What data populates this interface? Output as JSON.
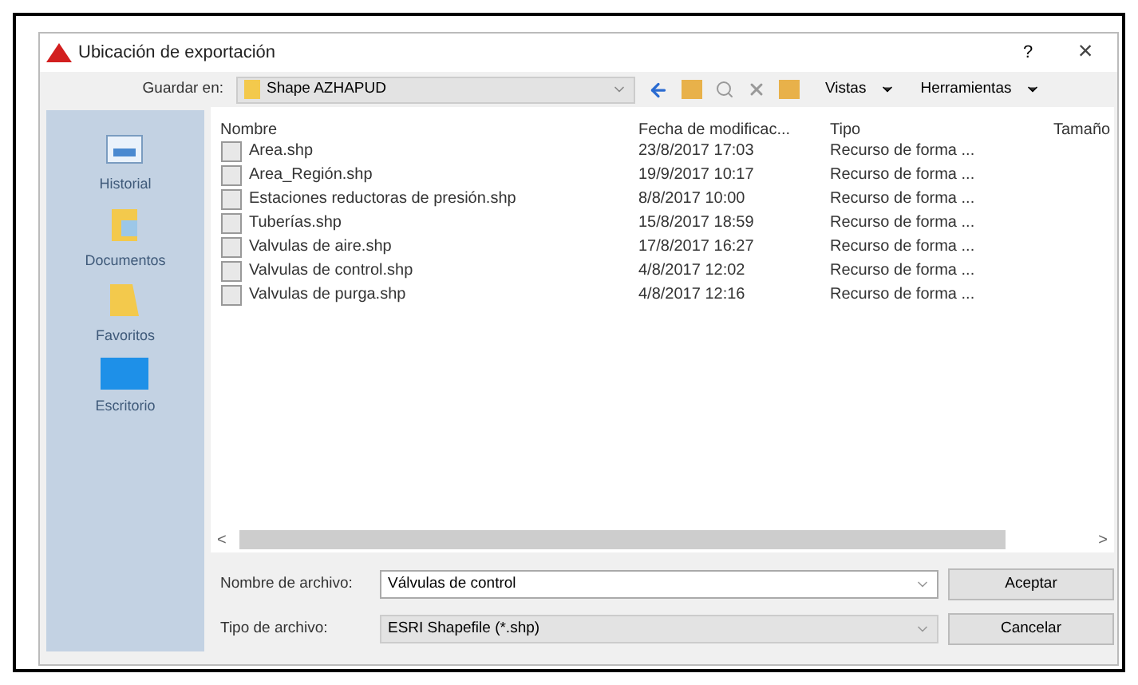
{
  "window": {
    "title": "Ubicación de exportación",
    "help": "?",
    "close": "×"
  },
  "toolbar": {
    "label": "Guardar en:",
    "location": "Shape AZHAPUD",
    "menus": [
      {
        "label": "Vistas"
      },
      {
        "label": "Herramientas"
      }
    ]
  },
  "sidebar": {
    "items": [
      {
        "label": "Historial",
        "kind": "history"
      },
      {
        "label": "Documentos",
        "kind": "documents"
      },
      {
        "label": "Favoritos",
        "kind": "favorites"
      },
      {
        "label": "Escritorio",
        "kind": "desktop"
      }
    ]
  },
  "table": {
    "columns": [
      "Nombre",
      "Fecha de modificac...",
      "Tipo",
      "Tamaño"
    ],
    "rows": [
      {
        "name": "Area.shp",
        "date": "23/8/2017 17:03",
        "type": "Recurso de forma ..."
      },
      {
        "name": "Area_Región.shp",
        "date": "19/9/2017 10:17",
        "type": "Recurso de forma ..."
      },
      {
        "name": "Estaciones reductoras de presión.shp",
        "date": "8/8/2017 10:00",
        "type": "Recurso de forma ..."
      },
      {
        "name": "Tuberías.shp",
        "date": "15/8/2017 18:59",
        "type": "Recurso de forma ..."
      },
      {
        "name": "Valvulas de aire.shp",
        "date": "17/8/2017 16:27",
        "type": "Recurso de forma ..."
      },
      {
        "name": "Valvulas de control.shp",
        "date": "4/8/2017 12:02",
        "type": "Recurso de forma ..."
      },
      {
        "name": "Valvulas de purga.shp",
        "date": "4/8/2017 12:16",
        "type": "Recurso de forma ..."
      }
    ]
  },
  "scroll": {
    "left": "<",
    "right": ">"
  },
  "fields": [
    {
      "label": "Nombre de archivo:",
      "value": "Válvulas de control",
      "button": "Aceptar",
      "kind": "input"
    },
    {
      "label": "Tipo de archivo:",
      "value": "ESRI Shapefile (*.shp)",
      "button": "Cancelar",
      "kind": "select"
    }
  ]
}
